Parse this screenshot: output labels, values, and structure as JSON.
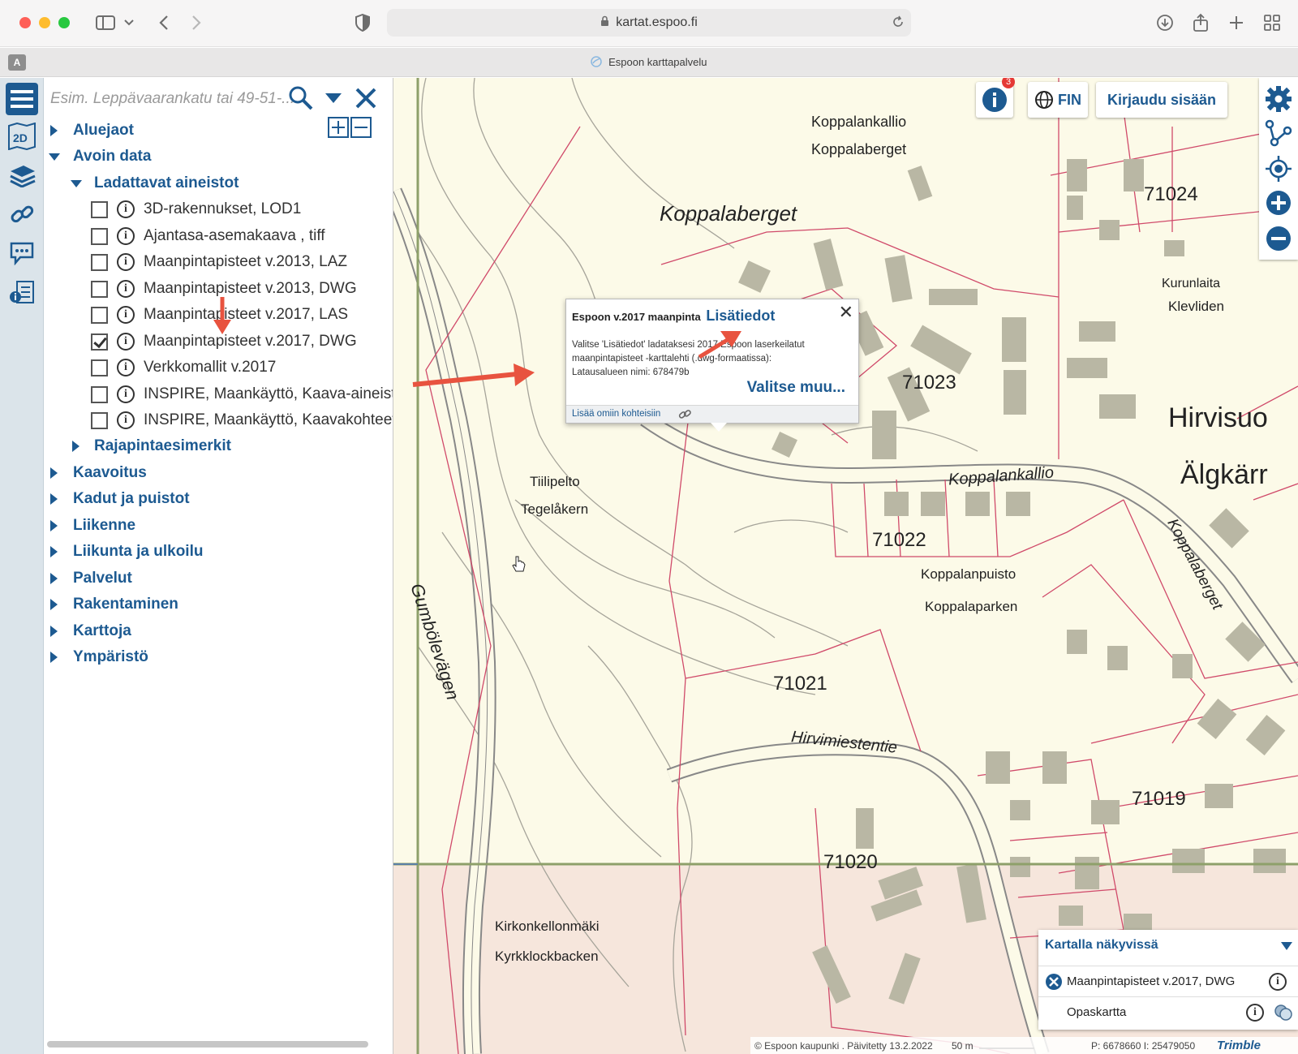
{
  "browser": {
    "url": "kartat.espoo.fi",
    "tab_title": "Espoon karttapalvelu",
    "account_letter": "A"
  },
  "search": {
    "placeholder": "Esim. Leppävaarankatu tai 49-51-..."
  },
  "tree": {
    "groups_top": [
      {
        "label": "Aluejaot",
        "expanded": false
      },
      {
        "label": "Avoin data",
        "expanded": true
      }
    ],
    "subgroup": {
      "label": "Ladattavat aineistot",
      "expanded": true
    },
    "layers": [
      {
        "label": "3D-rakennukset, LOD1",
        "checked": false
      },
      {
        "label": "Ajantasa-asemakaava , tiff",
        "checked": false
      },
      {
        "label": "Maanpintapisteet v.2013, LAZ",
        "checked": false
      },
      {
        "label": "Maanpintapisteet v.2013, DWG",
        "checked": false
      },
      {
        "label": "Maanpintapisteet v.2017, LAS",
        "checked": false
      },
      {
        "label": "Maanpintapisteet v.2017, DWG",
        "checked": true
      },
      {
        "label": "Verkkomallit v.2017",
        "checked": false
      },
      {
        "label": "INSPIRE, Maankäyttö, Kaava-aineistot",
        "checked": false
      },
      {
        "label": "INSPIRE, Maankäyttö, Kaavakohteet",
        "checked": false
      }
    ],
    "subgroup2": {
      "label": "Rajapintaesimerkit",
      "expanded": false
    },
    "groups_bottom": [
      {
        "label": "Kaavoitus"
      },
      {
        "label": "Kadut ja puistot"
      },
      {
        "label": "Liikenne"
      },
      {
        "label": "Liikunta ja ulkoilu"
      },
      {
        "label": "Palvelut"
      },
      {
        "label": "Rakentaminen"
      },
      {
        "label": "Karttoja"
      },
      {
        "label": "Ympäristö"
      }
    ]
  },
  "map_controls": {
    "info_badge": "3",
    "language": "FIN",
    "login": "Kirjaudu sisään"
  },
  "popup": {
    "title": "Espoon v.2017 maanpinta",
    "link": "Lisätiedot",
    "body_line1": "Valitse 'Lisätiedot' ladataksesi 2017 Espoon laserkeilatut",
    "body_line2": "maanpintapisteet -karttalehti (.dwg-formaatissa):",
    "body_line3": "Latausalueen nimi: 678479b",
    "choose_other": "Valitse muu...",
    "add_to_favorites": "Lisää omiin kohteisiin"
  },
  "visible_layers": {
    "title": "Kartalla näkyvissä",
    "items": [
      {
        "label": "Maanpintapisteet v.2017, DWG"
      },
      {
        "label": "Opaskartta"
      }
    ]
  },
  "map_labels": {
    "koppalankallio": "Koppalankallio",
    "koppalaberget_small": "Koppalaberget",
    "koppalaberget_big": "Koppalaberget",
    "kurunlaita": "Kurunlaita",
    "klevliden": "Klevliden",
    "hirvisuo": "Hirvisuo",
    "algkarr": "Älgkärr",
    "tiilipelto": "Tiilipelto",
    "tegelakern": "Tegelåkern",
    "koppalanpuisto": "Koppalanpuisto",
    "koppalaparken": "Koppalaparken",
    "kirkonkellonmaki": "Kirkonkellonmäki",
    "kyrkklockbacken": "Kyrkklockbacken",
    "gumbolevagen": "Gumbölevägen",
    "koppalankallio_street": "Koppalankallio",
    "koppalaberget_street": "Koppalaberget",
    "hirvimiestentie": "Hirvimiestentie",
    "lot_71024": "71024",
    "lot_71023": "71023",
    "lot_71022": "71022",
    "lot_71021": "71021",
    "lot_71020": "71020",
    "lot_71019": "71019"
  },
  "footer": {
    "copyright": "© Espoon kaupunki . Päivitetty 13.2.2022",
    "scale": "50 m",
    "coords": "P: 6678660 I: 25479050",
    "brand": "Trimble"
  },
  "colors": {
    "accent": "#1d5a91",
    "map_background": "#fcfae8",
    "parcel_line": "#d04a6a",
    "building": "#b9b7a4",
    "arrow": "#e8533f"
  }
}
